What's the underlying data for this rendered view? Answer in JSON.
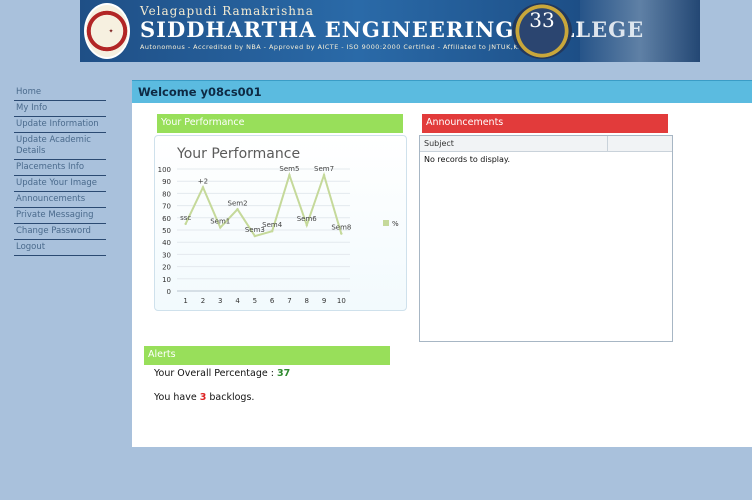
{
  "banner": {
    "subtitle": "Velagapudi Ramakrishna",
    "title": "SIDDHARTHA ENGINEERING COLLEGE",
    "accreditation": "Autonomous - Accredited by NBA - Approved by AICTE - ISO 9000:2000 Certified - Affiliated to JNTUK,Kakinada",
    "badge_number": "33"
  },
  "sidebar": {
    "items": [
      {
        "label": "Home"
      },
      {
        "label": "My Info"
      },
      {
        "label": "Update Information"
      },
      {
        "label": "Update Academic Details"
      },
      {
        "label": "Placements Info"
      },
      {
        "label": "Update Your Image"
      },
      {
        "label": "Announcements"
      },
      {
        "label": "Private Messaging"
      },
      {
        "label": "Change Password"
      },
      {
        "label": "Logout"
      }
    ]
  },
  "welcome": "Welcome y08cs001",
  "performance": {
    "header": "Your Performance"
  },
  "announcements": {
    "header": "Announcements",
    "column": "Subject",
    "empty_text": "No records to display."
  },
  "alerts": {
    "header": "Alerts",
    "overall_label": "Your Overall Percentage : ",
    "overall_value": "37",
    "backlog_prefix": "You have ",
    "backlog_value": "3",
    "backlog_suffix": " backlogs."
  },
  "colors": {
    "line": "#c5d99a",
    "accent_green": "#98df5a",
    "accent_red": "#e23b3b",
    "welcome_blue": "#5bbbe0"
  },
  "chart_data": {
    "type": "line",
    "title": "Your Performance",
    "x": [
      1,
      2,
      3,
      4,
      5,
      6,
      7,
      8,
      9,
      10
    ],
    "y": [
      55,
      85,
      52,
      67,
      45,
      49,
      95,
      54,
      95,
      47
    ],
    "point_labels": [
      "ssc",
      "+2",
      "Sem1",
      "Sem2",
      "Sem3",
      "Sem4",
      "Sem5",
      "Sem6",
      "Sem7",
      "Sem8"
    ],
    "legend": [
      "%"
    ],
    "xlim": [
      0.5,
      10.5
    ],
    "ylim": [
      0,
      100
    ],
    "yticks": [
      0,
      10,
      20,
      30,
      40,
      50,
      60,
      70,
      80,
      90,
      100
    ],
    "xticks": [
      1,
      2,
      3,
      4,
      5,
      6,
      7,
      8,
      9,
      10
    ],
    "grid": true,
    "legend_position": "right"
  }
}
